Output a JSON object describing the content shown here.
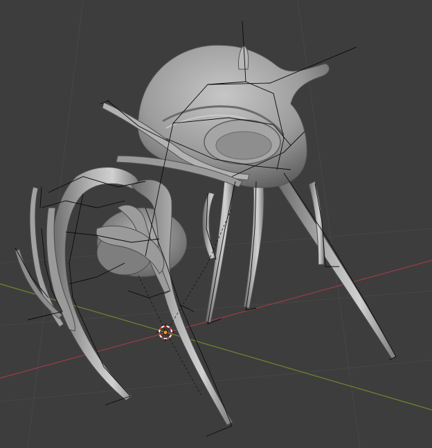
{
  "viewport": {
    "background_color": "#3d3d3d",
    "grid_line_color": "#484848",
    "x_axis_color": "#9e3b44",
    "y_axis_color": "#6c8a2c",
    "mesh_color": "#a9a9a9",
    "mesh_shadow_color": "#5c5c5c",
    "mesh_highlight_color": "#d2d2d2",
    "armature_color": "#000000",
    "cursor_outer_color": "#ffffff",
    "cursor_dash_color": "#d12a2a",
    "origin_color": "#ff9a1f",
    "cursor_icon": "3d-cursor-icon",
    "object_origin_icon": "object-origin-icon"
  }
}
